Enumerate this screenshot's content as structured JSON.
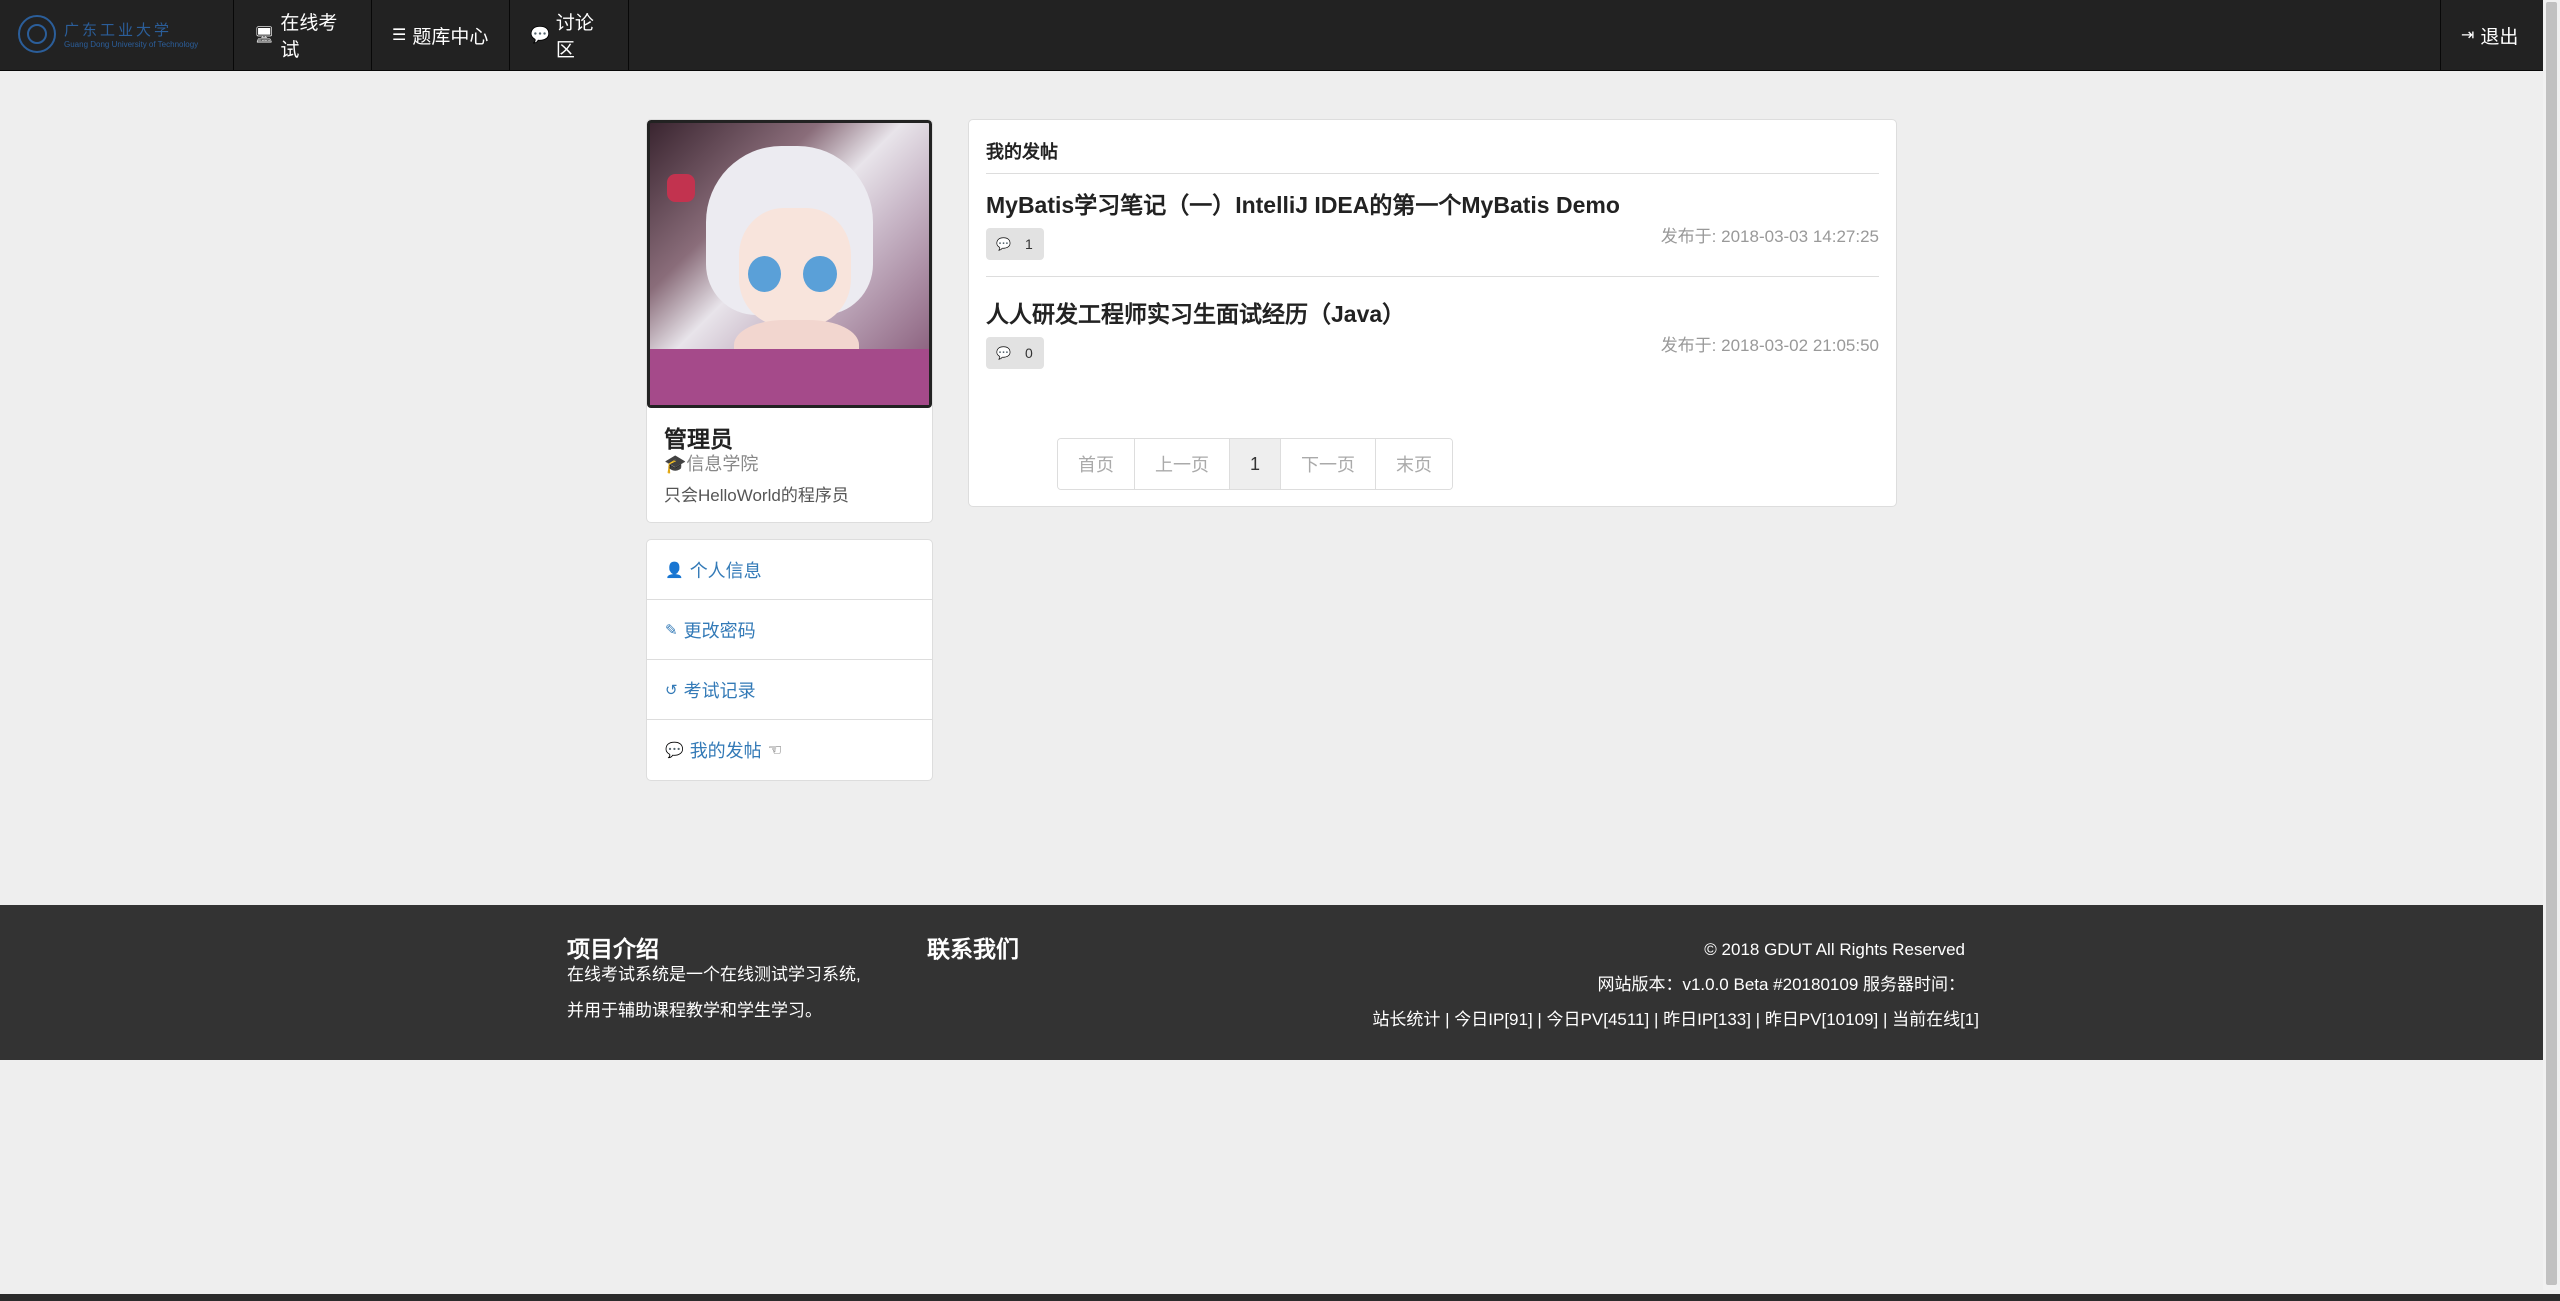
{
  "navbar": {
    "brand": {
      "name_cn": "广东工业大学",
      "name_en": "Guang Dong University of Technology"
    },
    "items": [
      {
        "label": "在线考试",
        "icon": "desktop-icon"
      },
      {
        "label": "题库中心",
        "icon": "list-icon"
      },
      {
        "label": "讨论区",
        "icon": "comment-icon"
      }
    ],
    "logout": {
      "label": "退出",
      "icon": "sign-out-icon"
    }
  },
  "profile": {
    "name": "管理员",
    "school": "信息学院",
    "bio": "只会HelloWorld的程序员"
  },
  "side_menu": {
    "items": [
      {
        "label": "个人信息",
        "icon": "user-icon"
      },
      {
        "label": "更改密码",
        "icon": "edit-icon"
      },
      {
        "label": "考试记录",
        "icon": "history-icon"
      },
      {
        "label": "我的发帖",
        "icon": "comments-icon"
      }
    ]
  },
  "posts": {
    "title": "我的发帖",
    "items": [
      {
        "title": "MyBatis学习笔记（一）IntelliJ IDEA的第一个MyBatis Demo",
        "comments": "1",
        "date": "发布于: 2018-03-03 14:27:25"
      },
      {
        "title": "人人研发工程师实习生面试经历（Java）",
        "comments": "0",
        "date": "发布于: 2018-03-02 21:05:50"
      }
    ],
    "pagination": {
      "first": "首页",
      "prev": "上一页",
      "current": "1",
      "next": "下一页",
      "last": "末页"
    }
  },
  "footer": {
    "intro_title": "项目介绍",
    "intro_line1": "在线考试系统是一个在线测试学习系统,",
    "intro_line2": "并用于辅助课程教学和学生学习。",
    "contact_title": "联系我们",
    "copyright": "© 2018 GDUT All Rights Reserved",
    "version": "网站版本：v1.0.0 Beta #20180109  服务器时间：",
    "stats": "站长统计 | 今日IP[91] | 今日PV[4511] | 昨日IP[133] | 昨日PV[10109] | 当前在线[1]"
  }
}
